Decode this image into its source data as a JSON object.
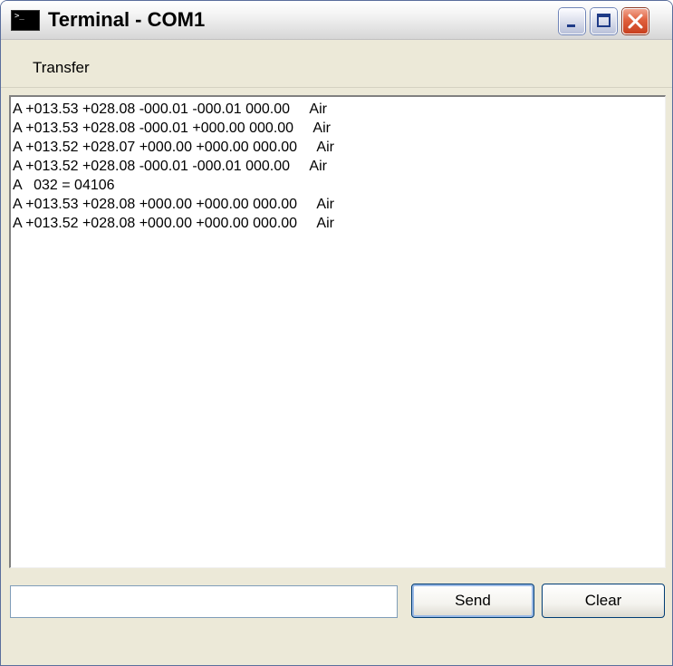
{
  "window": {
    "title": "Terminal - COM1",
    "icon": "terminal-icon"
  },
  "title_buttons": {
    "minimize": "minimize-icon",
    "maximize": "maximize-icon",
    "close": "close-icon"
  },
  "menu": {
    "items": [
      {
        "label": "Transfer"
      }
    ]
  },
  "output": {
    "lines": [
      "A +013.53 +028.08 -000.01 -000.01 000.00     Air",
      "A +013.53 +028.08 -000.01 +000.00 000.00     Air",
      "A +013.52 +028.07 +000.00 +000.00 000.00     Air",
      "A +013.52 +028.08 -000.01 -000.01 000.00     Air",
      "A   032 = 04106",
      "A +013.53 +028.08 +000.00 +000.00 000.00     Air",
      "A +013.52 +028.08 +000.00 +000.00 000.00     Air"
    ]
  },
  "input": {
    "value": "",
    "placeholder": ""
  },
  "buttons": {
    "send_label": "Send",
    "clear_label": "Clear"
  },
  "colors": {
    "title_bar": "#e4e4e4",
    "window_face": "#ece9d8",
    "close_button": "#e0603d",
    "focus_ring": "#99b9e6"
  }
}
